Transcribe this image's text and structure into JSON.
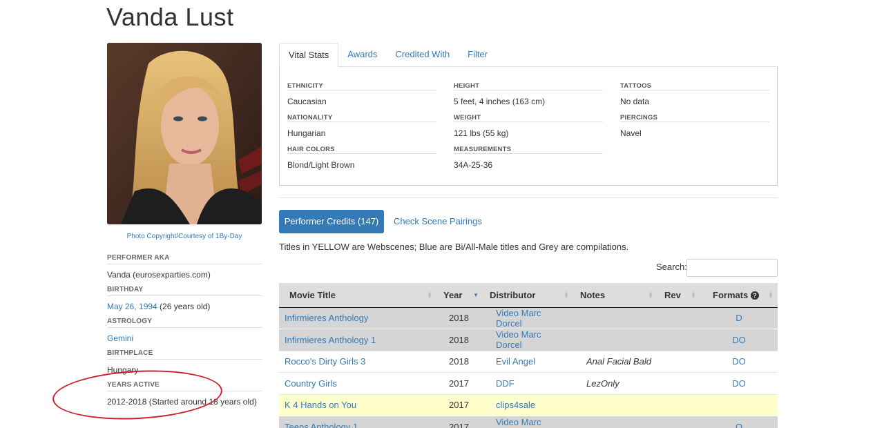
{
  "performer": {
    "name": "Vanda Lust"
  },
  "photo": {
    "caption": "Photo Copyright/Courtesy of 1By-Day"
  },
  "bio": {
    "aka_label": "PERFORMER AKA",
    "aka_value": "Vanda (eurosexparties.com)",
    "birthday_label": "BIRTHDAY",
    "birthday_date": "May 26, 1994",
    "birthday_age": " (26 years old)",
    "astrology_label": "ASTROLOGY",
    "astrology_value": "Gemini",
    "birthplace_label": "BIRTHPLACE",
    "birthplace_value": "Hungary",
    "years_active_label": "YEARS ACTIVE",
    "years_active_value": "2012-2018 (Started around 18 years old)"
  },
  "tabs": [
    "Vital Stats",
    "Awards",
    "Credited With",
    "Filter"
  ],
  "vital_stats": {
    "col1": [
      {
        "label": "ETHNICITY",
        "value": "Caucasian"
      },
      {
        "label": "NATIONALITY",
        "value": "Hungarian"
      },
      {
        "label": "HAIR COLORS",
        "value": "Blond/Light Brown"
      }
    ],
    "col2": [
      {
        "label": "HEIGHT",
        "value": "5 feet, 4 inches (163 cm)"
      },
      {
        "label": "WEIGHT",
        "value": "121 lbs (55 kg)"
      },
      {
        "label": "MEASUREMENTS",
        "value": "34A-25-36"
      }
    ],
    "col3": [
      {
        "label": "TATTOOS",
        "value": "No data"
      },
      {
        "label": "PIERCINGS",
        "value": "Navel"
      }
    ]
  },
  "credits": {
    "button_label": "Performer Credits (147)",
    "pairings_label": "Check Scene Pairings",
    "legend": "Titles in YELLOW are Webscenes; Blue are Bi/All-Male titles and Grey are compilations.",
    "search_label": "Search:",
    "search_value": "",
    "columns": [
      "Movie Title",
      "Year",
      "Distributor",
      "Notes",
      "Rev",
      "Formats"
    ],
    "rows": [
      {
        "title": "Infirmieres Anthology",
        "year": "2018",
        "distributor": "Video Marc Dorcel",
        "notes": "",
        "rev": "",
        "formats": "D"
      },
      {
        "title": "Infirmieres Anthology 1",
        "year": "2018",
        "distributor": "Video Marc Dorcel",
        "notes": "",
        "rev": "",
        "formats": "DO"
      },
      {
        "title": "Rocco's Dirty Girls 3",
        "year": "2018",
        "distributor": "Evil Angel",
        "notes": "Anal Facial Bald",
        "rev": "",
        "formats": "DO"
      },
      {
        "title": "Country Girls",
        "year": "2017",
        "distributor": "DDF",
        "notes": "LezOnly",
        "rev": "",
        "formats": "DO"
      },
      {
        "title": "K 4 Hands on You",
        "year": "2017",
        "distributor": "clips4sale",
        "notes": "",
        "rev": "",
        "formats": ""
      },
      {
        "title": "Teens Anthology 1",
        "year": "2017",
        "distributor": "Video Marc Dorcel",
        "notes": "",
        "rev": "",
        "formats": "O"
      }
    ],
    "row_types": [
      "grey",
      "grey",
      "white",
      "white",
      "yellow",
      "grey"
    ]
  },
  "colors": {
    "accent": "#337ab7",
    "webscene": "#ffffcc",
    "compilation": "#d5d5d5",
    "annotation": "#cc1f2e"
  }
}
